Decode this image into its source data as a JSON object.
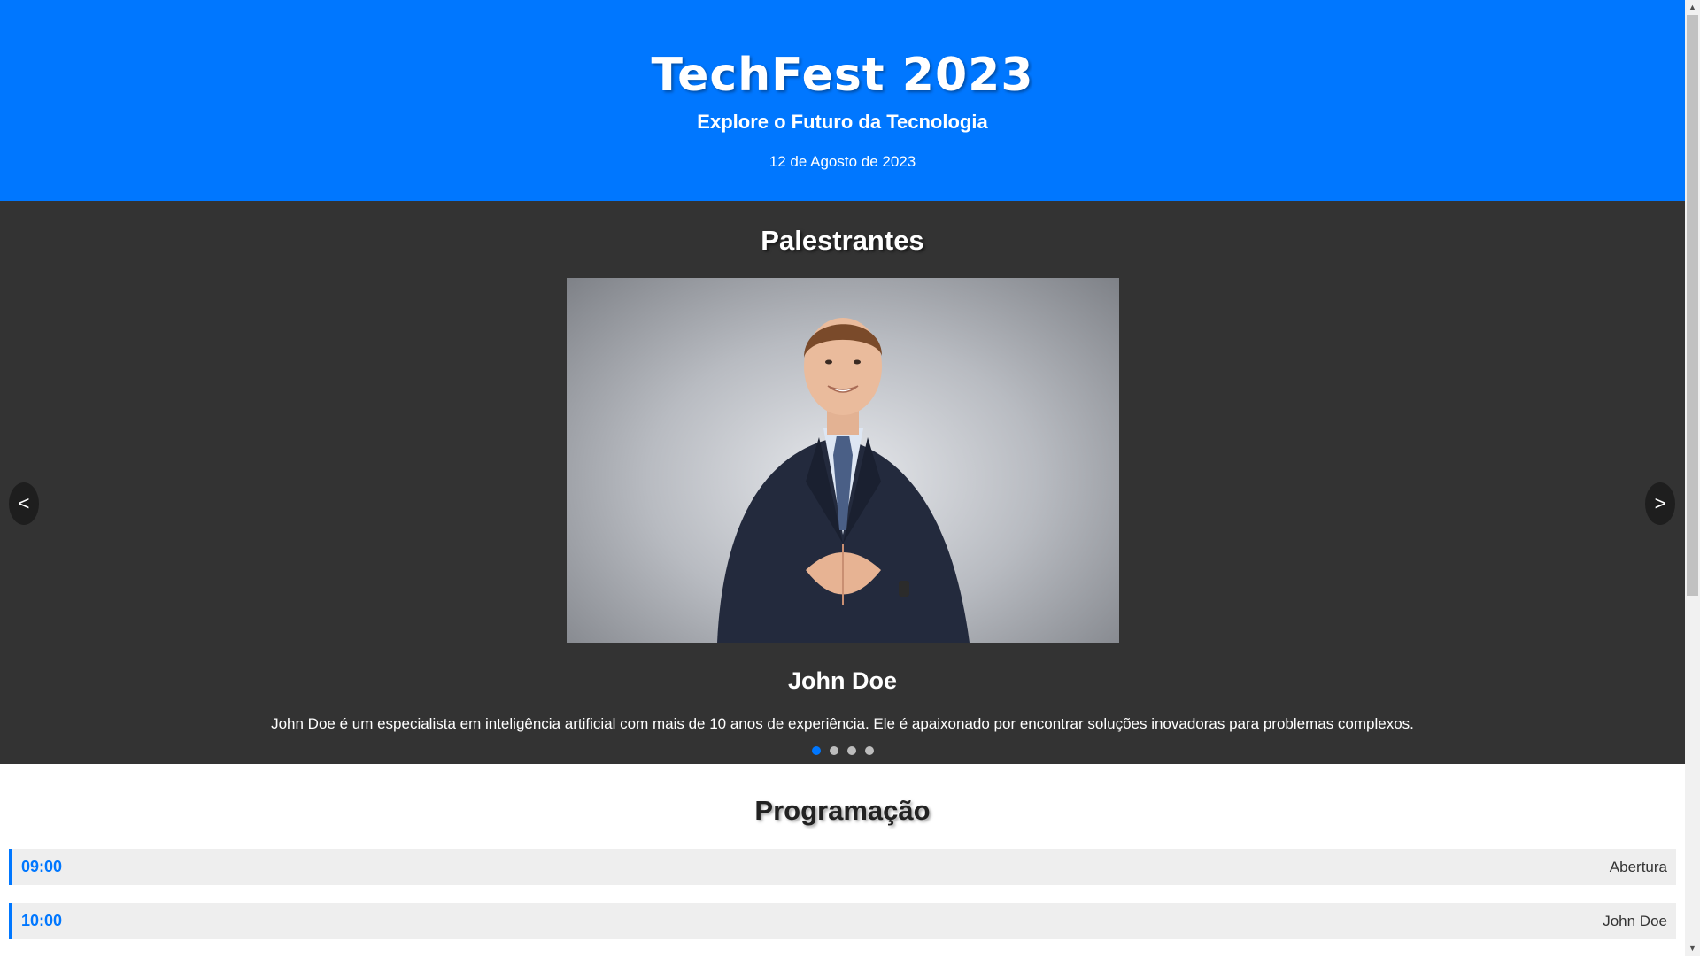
{
  "hero": {
    "title": "TechFest 2023",
    "subtitle": "Explore o Futuro da Tecnologia",
    "date": "12 de Agosto de 2023",
    "background_color": "#0077ff"
  },
  "speakers": {
    "heading": "Palestrantes",
    "prev_label": "<",
    "next_label": ">",
    "current": {
      "name": "John Doe",
      "bio": "John Doe é um especialista em inteligência artificial com mais de 10 anos de experiência. Ele é apaixonado por encontrar soluções inovadoras para problemas complexos.",
      "photo": "speaker-portrait"
    },
    "slide_count": 4,
    "active_slide": 1,
    "background_color": "#333333"
  },
  "schedule": {
    "heading": "Programação",
    "items": [
      {
        "time": "09:00",
        "title": "Abertura"
      },
      {
        "time": "10:00",
        "title": "John Doe"
      }
    ],
    "accent_color": "#0077ff"
  },
  "scrollbar": {
    "up_icon": "▲",
    "down_icon": "▼"
  }
}
